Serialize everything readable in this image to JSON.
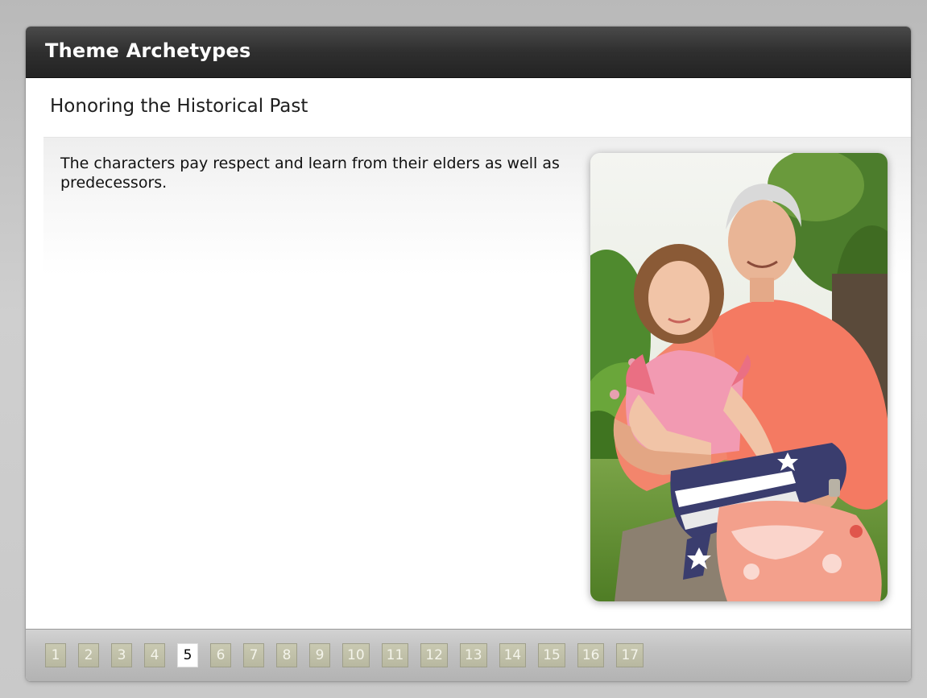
{
  "window": {
    "title": "Theme Archetypes"
  },
  "slide": {
    "heading": "Honoring the Historical Past",
    "body": "The characters pay respect and learn from their elders as well as predecessors.",
    "image_alt": "Elderly man holding a young girl who holds a folded American flag, outdoors in a garden"
  },
  "pagination": {
    "current": 5,
    "pages": [
      "1",
      "2",
      "3",
      "4",
      "5",
      "6",
      "7",
      "8",
      "9",
      "10",
      "11",
      "12",
      "13",
      "14",
      "15",
      "16",
      "17"
    ]
  },
  "colors": {
    "titlebar": "#2f2f2f",
    "page_button": "#c2c2aa",
    "page_button_current": "#ffffff",
    "shirt": "#f3785f",
    "flag_blue": "#3a3d6e",
    "grass": "#5b8a2e"
  }
}
